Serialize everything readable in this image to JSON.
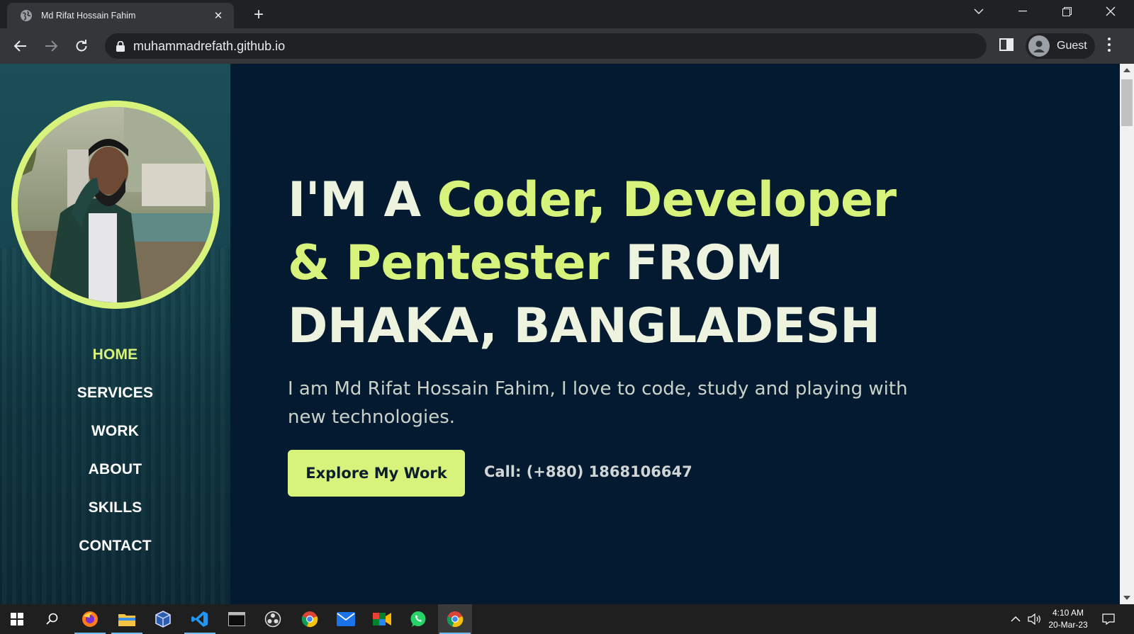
{
  "browser": {
    "tab_title": "Md Rifat Hossain Fahim",
    "url": "muhammadrefath.github.io",
    "profile_name": "Guest"
  },
  "sidebar": {
    "nav": [
      {
        "label": "HOME",
        "active": true
      },
      {
        "label": "SERVICES",
        "active": false
      },
      {
        "label": "WORK",
        "active": false
      },
      {
        "label": "ABOUT",
        "active": false
      },
      {
        "label": "SKILLS",
        "active": false
      },
      {
        "label": "CONTACT",
        "active": false
      }
    ]
  },
  "hero": {
    "headline_part1": "I'M A ",
    "headline_highlight": "Coder, Developer & Pentester",
    "headline_part2": " FROM DHAKA, BANGLADESH",
    "subtitle": "I am Md Rifat Hossain Fahim, I love to code, study and playing with new technologies.",
    "cta_label": "Explore My Work",
    "call_text": "Call: (+880) 1868106647"
  },
  "taskbar": {
    "time": "4:10 AM",
    "date": "20-Mar-23"
  },
  "colors": {
    "accent": "#d8f37b",
    "page_bg": "#031a30",
    "sidebar_bg": "#174650"
  }
}
